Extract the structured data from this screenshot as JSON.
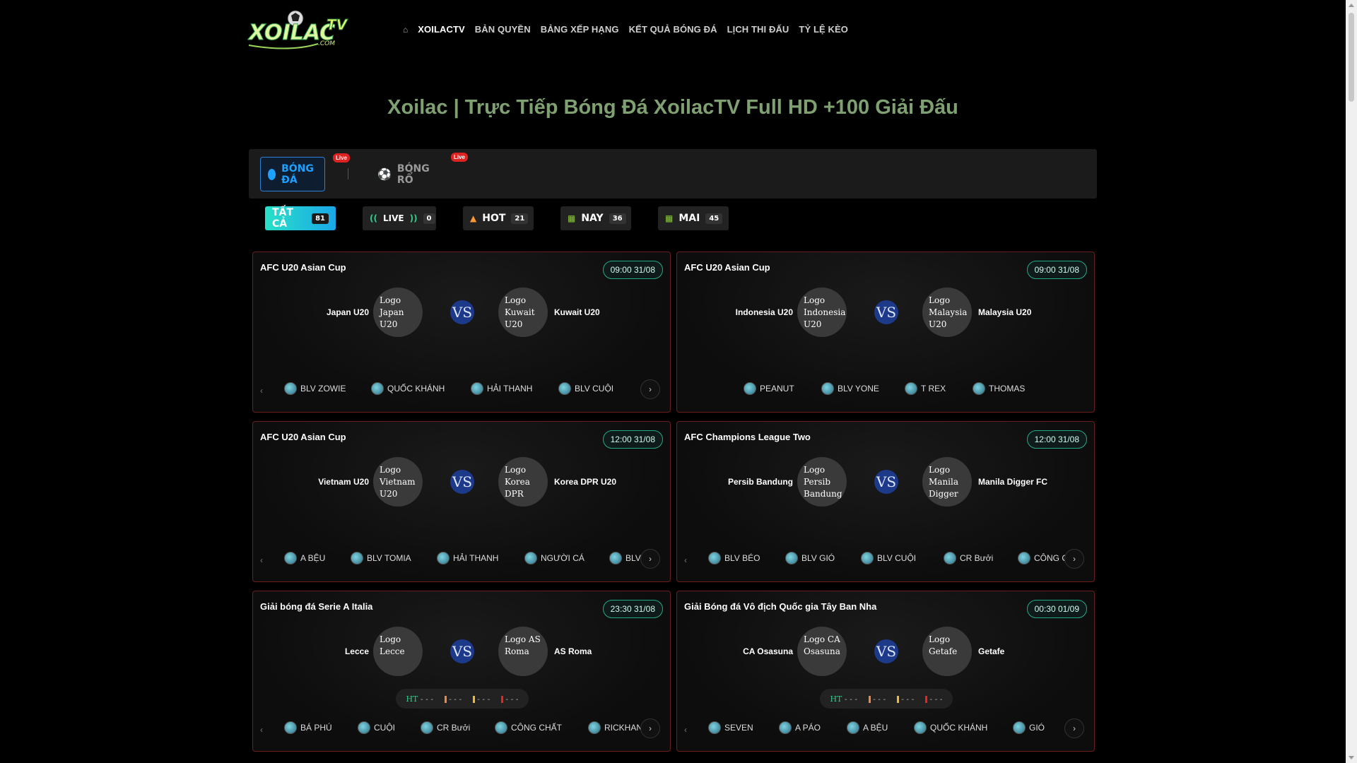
{
  "header": {
    "logo_text": "XOILAC TV .COM",
    "home_icon": "home-icon",
    "nav": [
      "XOILACTV",
      "BẢN QUYỀN",
      "BẢNG XẾP HẠNG",
      "KẾT QUẢ BÓNG ĐÁ",
      "LỊCH THI ĐẤU",
      "TỶ LỆ KÈO"
    ]
  },
  "title": "Xoilac | Trực Tiếp Bóng Đá XoilacTV Full HD +100 Giải Đấu",
  "sports": [
    {
      "label": "BÓNG ĐÁ",
      "badge": "Live"
    },
    {
      "label": "BÓNG RỔ",
      "badge": "Live"
    }
  ],
  "filters": [
    {
      "label": "TẤT CẢ",
      "count": "81"
    },
    {
      "label": "LIVE",
      "count": "0"
    },
    {
      "label": "HOT",
      "count": "21"
    },
    {
      "label": "NAY",
      "count": "36"
    },
    {
      "label": "MAI",
      "count": "45"
    }
  ],
  "colors": {
    "accent": "#1ea0ff",
    "title": "#7fa071",
    "card_border": "#6b1e1e",
    "vs_bg": "#1d3a8a"
  },
  "matches": [
    {
      "league": "AFC U20 Asian Cup",
      "time": "09:00 31/08",
      "home": "Japan U20",
      "away": "Kuwait U20",
      "home_logo_alt": "Logo Japan U20",
      "away_logo_alt": "Logo Kuwait U20",
      "vs": "VS",
      "blvs": [
        "BLV ZOWIE",
        "QUỐC KHÁNH",
        "HẢI THANH",
        "BLV CUỘI"
      ]
    },
    {
      "league": "AFC U20 Asian Cup",
      "time": "09:00 31/08",
      "home": "Indonesia U20",
      "away": "Malaysia U20",
      "home_logo_alt": "Logo Indonesia U20",
      "away_logo_alt": "Logo Malaysia U20",
      "vs": "VS",
      "blvs": [
        "PEANUT",
        "BLV YONE",
        "T REX",
        "THOMAS"
      ]
    },
    {
      "league": "AFC U20 Asian Cup",
      "time": "12:00 31/08",
      "home": "Vietnam U20",
      "away": "Korea DPR U20",
      "home_logo_alt": "Logo Vietnam U20",
      "away_logo_alt": "Logo Korea DPR",
      "vs": "VS",
      "blvs": [
        "A BỆU",
        "BLV TOMIA",
        "HẢI THANH",
        "NGƯỜI CÁ",
        "BLV T"
      ]
    },
    {
      "league": "AFC Champions League Two",
      "time": "12:00 31/08",
      "home": "Persib Bandung",
      "away": "Manila Digger FC",
      "home_logo_alt": "Logo Persib Bandung",
      "away_logo_alt": "Logo Manila Digger",
      "vs": "VS",
      "blvs": [
        "BLV BÉO",
        "BLV GIÓ",
        "BLV CUỘI",
        "CR Bưởi",
        "CÔNG CH"
      ]
    },
    {
      "league": "Giải bóng đá Serie A Italia",
      "time": "23:30 31/08",
      "home": "Lecce",
      "away": "AS Roma",
      "home_logo_alt": "Logo Lecce",
      "away_logo_alt": "Logo AS Roma",
      "vs": "VS",
      "score": {
        "ht": "HT",
        "dash": "- - -"
      },
      "blvs": [
        "BÁ PHÚ",
        "CUỘI",
        "CR Bưởi",
        "CÔNG CHẤT",
        "RICKHAND"
      ]
    },
    {
      "league": "Giải Bóng đá Vô địch Quốc gia Tây Ban Nha",
      "time": "00:30 01/09",
      "home": "CA Osasuna",
      "away": "Getafe",
      "home_logo_alt": "Logo CA Osasuna",
      "away_logo_alt": "Logo Getafe",
      "vs": "VS",
      "score": {
        "ht": "HT",
        "dash": "- - -"
      },
      "blvs": [
        "SEVEN",
        "A PÁO",
        "A BỆU",
        "QUỐC KHÁNH",
        "GIÓ"
      ]
    }
  ]
}
